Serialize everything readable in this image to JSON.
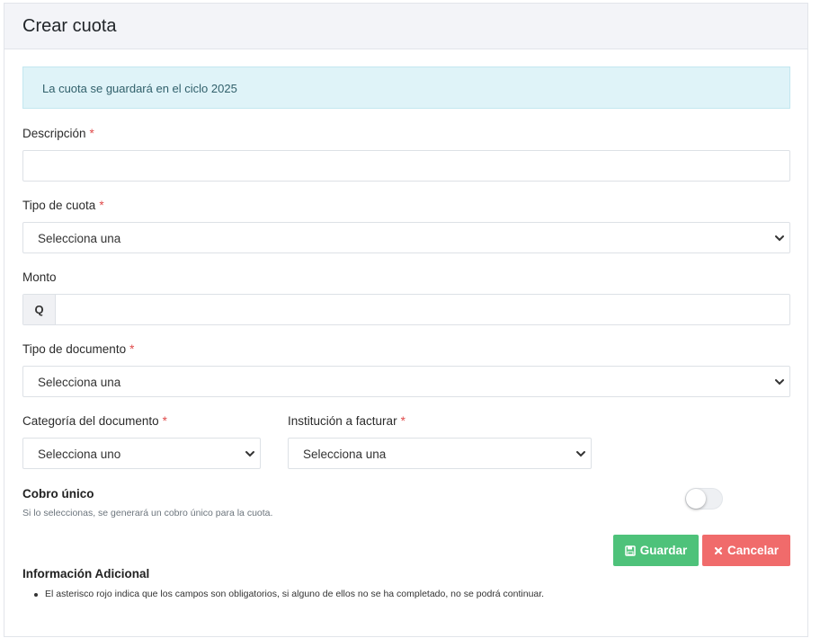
{
  "header": {
    "title": "Crear cuota"
  },
  "alert": {
    "text": "La cuota se guardará en el ciclo 2025"
  },
  "fields": {
    "descripcion": {
      "label": "Descripción",
      "required_mark": "*",
      "value": ""
    },
    "tipo_cuota": {
      "label": "Tipo de cuota",
      "required_mark": "*",
      "selected": "Selecciona una"
    },
    "monto": {
      "label": "Monto",
      "prefix": "Q",
      "value": ""
    },
    "tipo_documento": {
      "label": "Tipo de documento",
      "required_mark": "*",
      "selected": "Selecciona una"
    },
    "categoria_documento": {
      "label": "Categoría del documento",
      "required_mark": "*",
      "selected": "Selecciona uno"
    },
    "institucion_facturar": {
      "label": "Institución a facturar",
      "required_mark": "*",
      "selected": "Selecciona una"
    }
  },
  "cobro_unico": {
    "title": "Cobro único",
    "help": "Si lo seleccionas, se generará un cobro único para la cuota.",
    "enabled": false
  },
  "buttons": {
    "save_label": "Guardar",
    "cancel_label": "Cancelar"
  },
  "info": {
    "title": "Información Adicional",
    "items": [
      "El asterisco rojo indica que los campos son obligatorios, si alguno de ellos no se ha completado, no se podrá continuar."
    ]
  },
  "colors": {
    "success": "#4ec27a",
    "danger": "#f06b6b",
    "alert_bg": "#dff3f8",
    "required": "#e04b4b"
  },
  "icons": {
    "save": "floppy-disk-icon",
    "cancel": "x-icon",
    "select": "chevron-down-icon"
  }
}
